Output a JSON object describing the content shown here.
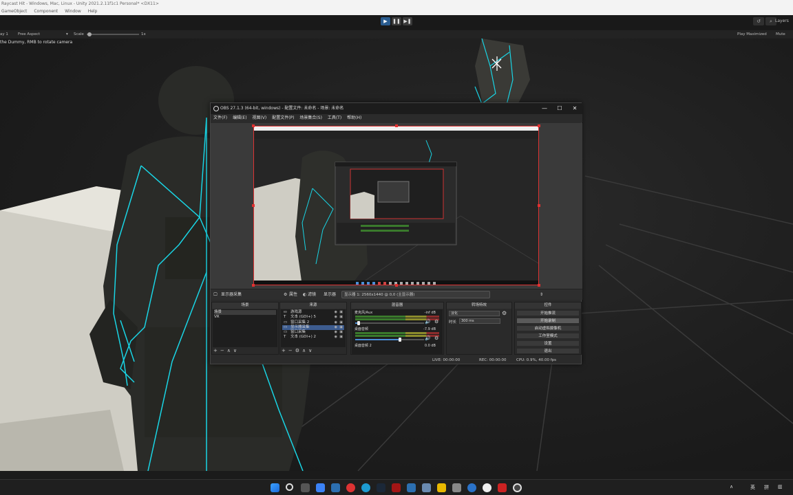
{
  "unity": {
    "title": "Raycast Hit - Windows, Mac, Linux - Unity 2021.2.11f1c1 Personal* <DX11>",
    "menu": [
      "GameObject",
      "Component",
      "Window",
      "Help"
    ],
    "layers_label": "Layers",
    "game_bar": {
      "display": "ay 1",
      "aspect": "Free Aspect",
      "scale_label": "Scale",
      "scale_value": "1x",
      "play_mode": "Play Maximized",
      "mute": "Mute Aud"
    },
    "hint": "the Dummy, RMB to rotate camera"
  },
  "obs": {
    "title": "OBS 27.1.3 (64-bit, windows) - 配置文件: 未命名 - 场景: 未命名",
    "menu": [
      "文件(F)",
      "编辑(E)",
      "视图(V)",
      "配置文件(P)",
      "场景集合(S)",
      "工具(T)",
      "帮助(H)"
    ],
    "window_controls": {
      "minimize": "—",
      "maximize": "☐",
      "close": "✕"
    },
    "source_bar": {
      "current_source": "显示器采集",
      "properties": "属性",
      "filters": "滤镜",
      "display_label": "显示器",
      "display_value": "显示器 1: 2560x1440 @ 0,0 (主显示器)"
    },
    "scenes": {
      "title": "场景",
      "items": [
        {
          "label": "场景",
          "selected": true
        },
        {
          "label": "VR",
          "selected": false
        }
      ]
    },
    "sources": {
      "title": "来源",
      "items": [
        {
          "icon": "game-capture-icon",
          "glyph": "⛀",
          "label": "游戏源",
          "selected": false
        },
        {
          "icon": "text-icon",
          "glyph": "T",
          "label": "文本 (GDI+) 5",
          "selected": false
        },
        {
          "icon": "window-capture-icon",
          "glyph": "▭",
          "label": "窗口采集 2",
          "selected": false
        },
        {
          "icon": "display-capture-icon",
          "glyph": "▭",
          "label": "显示器采集",
          "selected": true
        },
        {
          "icon": "window-capture-icon",
          "glyph": "▭",
          "label": "窗口采集",
          "selected": false
        },
        {
          "icon": "text-icon",
          "glyph": "T",
          "label": "文本 (GDI+) 2",
          "selected": false
        }
      ]
    },
    "mixer": {
      "title": "混音器",
      "channels": [
        {
          "name": "麦克风/Aux",
          "db": "-inf dB",
          "volume_level": 0.05
        },
        {
          "name": "桌面音频",
          "db": "-7.9 dB",
          "volume_level": 0.65
        },
        {
          "name": "桌面音频 2",
          "db": "0.0 dB",
          "volume_level": 1.0
        }
      ]
    },
    "transitions": {
      "title": "转场特效",
      "selected": "淡化",
      "duration_label": "时长",
      "duration_value": "300 ms"
    },
    "controls": {
      "title": "控件",
      "buttons": [
        {
          "label": "开始推流",
          "active": false
        },
        {
          "label": "开始录制",
          "active": true
        },
        {
          "label": "启动虚拟摄像机",
          "active": false
        },
        {
          "label": "工作室模式",
          "active": false
        },
        {
          "label": "设置",
          "active": false
        },
        {
          "label": "退出",
          "active": false
        }
      ]
    },
    "status": {
      "live": "LIVE: 00:00:00",
      "rec": "REC: 00:00:00",
      "cpu": "CPU: 0.9%, 40.00 fps"
    }
  },
  "taskbar": {
    "tray_lang": "英",
    "tray_ime": "拼"
  },
  "colors": {
    "accent": "#2a5c8f",
    "skeleton": "#19d6e6",
    "preview_border": "#d33"
  }
}
